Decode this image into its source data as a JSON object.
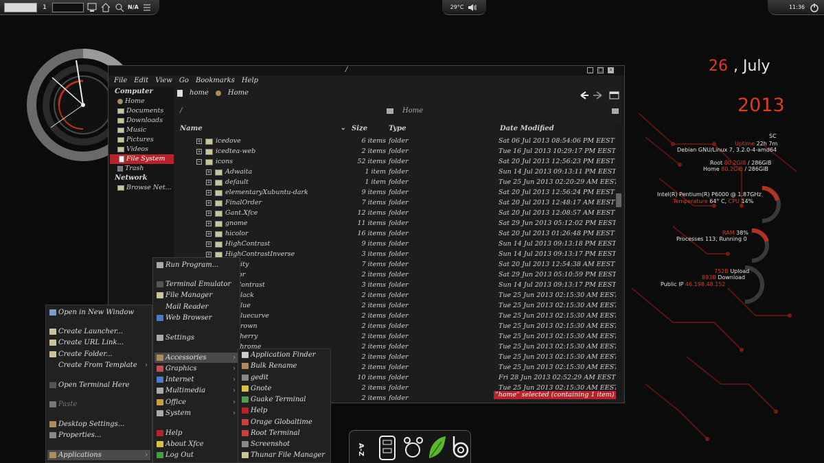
{
  "panel": {
    "workspace_number": "1",
    "network_label": "N/A",
    "temperature": "29°C",
    "clock_time": "11:36"
  },
  "date": {
    "day": "26",
    "month": ", July",
    "year": "2013"
  },
  "conky": {
    "user": "SC",
    "uptime_label": "Uptime",
    "uptime_value": "22h 7m",
    "os": "Debian GNU/Linux 7, 3.2.0-4-amd64",
    "root_label": "Root",
    "root_used": "80.2GiB",
    "root_total": "/ 286GiB",
    "home_label": "Home",
    "home_used": "80.2GiB",
    "home_total": "/ 286GiB",
    "cpu_model": "Intel(R) Pentium(R)  P6000  @ 1.87GHz",
    "temperature_label": "Temperature",
    "temperature_value": "64° C,",
    "cpu_label": "CPU",
    "cpu_value": "14%",
    "ram_label": "RAM",
    "ram_value": "38%",
    "processes": "Processes 113, Running 0",
    "upload_value": "752B",
    "upload_label": "Upload",
    "download_value": "893B",
    "download_label": "Download",
    "public_ip_label": "Public IP",
    "public_ip": "46.198.48.152"
  },
  "file_manager": {
    "title": "/",
    "menu": [
      "File",
      "Edit",
      "View",
      "Go",
      "Bookmarks",
      "Help"
    ],
    "sidebar": {
      "computer_heading": "Computer",
      "computer_items": [
        "Home",
        "Documents",
        "Downloads",
        "Music",
        "Pictures",
        "Videos",
        "File System",
        "Trash"
      ],
      "network_heading": "Network",
      "network_items": [
        "Browse Net..."
      ]
    },
    "path_buttons": [
      "home",
      "Home"
    ],
    "location_left": "/",
    "location_center": "Home",
    "columns": {
      "name": "Name",
      "size": "Size",
      "type": "Type",
      "modified": "Date Modified"
    },
    "rows": [
      {
        "name": "icedove",
        "size": "6 items",
        "type": "folder",
        "date": "Sat 06 Jul 2013 08:54:06 PM EEST",
        "level": 1,
        "exp": "+"
      },
      {
        "name": "icedtea-web",
        "size": "2 items",
        "type": "folder",
        "date": "Tue 16 Jul 2013 10:29:17 PM EEST",
        "level": 1,
        "exp": "+"
      },
      {
        "name": "icons",
        "size": "52 items",
        "type": "folder",
        "date": "Sat 20 Jul 2013 12:56:23 PM EEST",
        "level": 1,
        "exp": "−"
      },
      {
        "name": "Adwaita",
        "size": "1 item",
        "type": "folder",
        "date": "Sun 14 Jul 2013 09:13:11 PM EEST",
        "level": 2,
        "exp": "+"
      },
      {
        "name": "default",
        "size": "1 item",
        "type": "folder",
        "date": "Tue 25 Jun 2013 02:20:29 AM EEST",
        "level": 2,
        "exp": "+"
      },
      {
        "name": "elementaryXubuntu-dark",
        "size": "9 items",
        "type": "folder",
        "date": "Sat 20 Jul 2013 12:56:24 PM EEST",
        "level": 2,
        "exp": "+"
      },
      {
        "name": "FinalOrder",
        "size": "7 items",
        "type": "folder",
        "date": "Sat 20 Jul 2013 12:48:17 AM EEST",
        "level": 2,
        "exp": "+"
      },
      {
        "name": "Gant.Xfce",
        "size": "12 items",
        "type": "folder",
        "date": "Sat 20 Jul 2013 12:08:57 AM EEST",
        "level": 2,
        "exp": "+"
      },
      {
        "name": "gnome",
        "size": "11 items",
        "type": "folder",
        "date": "Sat 29 Jun 2013 05:12:02 PM EEST",
        "level": 2,
        "exp": "+"
      },
      {
        "name": "hicolor",
        "size": "16 items",
        "type": "folder",
        "date": "Sat 20 Jul 2013 01:26:48 PM EEST",
        "level": 2,
        "exp": "+"
      },
      {
        "name": "HighContrast",
        "size": "9 items",
        "type": "folder",
        "date": "Sun 14 Jul 2013 09:13:18 PM EEST",
        "level": 2,
        "exp": "+"
      },
      {
        "name": "HighContrastInverse",
        "size": "3 items",
        "type": "folder",
        "date": "Sun 14 Jul 2013 09:13:17 PM EEST",
        "level": 2,
        "exp": "+"
      },
      {
        "name": "nity",
        "size": "7 items",
        "type": "folder",
        "date": "Sat 20 Jul 2013 12:54:38 AM EEST",
        "level": 2,
        "exp": ""
      },
      {
        "name": "lor",
        "size": "2 items",
        "type": "folder",
        "date": "Sat 29 Jun 2013 05:10:59 PM EEST",
        "level": 2,
        "exp": ""
      },
      {
        "name": "Contrast",
        "size": "3 items",
        "type": "folder",
        "date": "Sun 14 Jul 2013 09:13:17 PM EEST",
        "level": 2,
        "exp": ""
      },
      {
        "name": "black",
        "size": "2 items",
        "type": "folder",
        "date": "Tue 25 Jun 2013 02:15:30 AM EEST",
        "level": 2,
        "exp": ""
      },
      {
        "name": "blue",
        "size": "2 items",
        "type": "folder",
        "date": "Tue 25 Jun 2013 02:15:30 AM EEST",
        "level": 2,
        "exp": ""
      },
      {
        "name": "bluecurve",
        "size": "2 items",
        "type": "folder",
        "date": "Tue 25 Jun 2013 02:15:30 AM EEST",
        "level": 2,
        "exp": ""
      },
      {
        "name": "brown",
        "size": "2 items",
        "type": "folder",
        "date": "Tue 25 Jun 2013 02:15:30 AM EEST",
        "level": 2,
        "exp": ""
      },
      {
        "name": "cherry",
        "size": "2 items",
        "type": "folder",
        "date": "Tue 25 Jun 2013 02:15:30 AM EEST",
        "level": 2,
        "exp": ""
      },
      {
        "name": "chrome",
        "size": "2 items",
        "type": "folder",
        "date": "Tue 25 Jun 2013 02:15:30 AM EEST",
        "level": 2,
        "exp": ""
      },
      {
        "name": "",
        "size": "2 items",
        "type": "folder",
        "date": "Tue 25 Jun 2013 02:15:30 AM EEST",
        "level": 2,
        "exp": ""
      },
      {
        "name": "",
        "size": "2 items",
        "type": "folder",
        "date": "Tue 25 Jun 2013 02:15:30 AM EEST",
        "level": 2,
        "exp": ""
      },
      {
        "name": "",
        "size": "10 items",
        "type": "folder",
        "date": "Fri 28 Jun 2013 02:52:29 AM EEST",
        "level": 2,
        "exp": ""
      },
      {
        "name": "",
        "size": "2 items",
        "type": "folder",
        "date": "Tue 25 Jun 2013 02:15:30 AM EEST",
        "level": 2,
        "exp": ""
      },
      {
        "name": "",
        "size": "2 items",
        "type": "folder",
        "date": "",
        "level": 2,
        "exp": ""
      }
    ],
    "status": "\"home\" selected (containing 1 item)"
  },
  "desktop_menu": {
    "items": [
      {
        "label": "Open in New Window",
        "icon": "#7aa0c8"
      },
      {
        "label": "Create Launcher...",
        "icon": "#c9c49a"
      },
      {
        "label": "Create URL Link...",
        "icon": "#c9c49a"
      },
      {
        "label": "Create Folder...",
        "icon": "#c9c49a"
      },
      {
        "label": "Create From Template",
        "icon": ""
      },
      {
        "label": "Open Terminal Here",
        "icon": "#555"
      },
      {
        "label": "Paste",
        "icon": "#777"
      },
      {
        "label": "Desktop Settings...",
        "icon": "#b08a5a"
      },
      {
        "label": "Properties...",
        "icon": "#888"
      },
      {
        "label": "Applications",
        "icon": "#b08a5a"
      }
    ]
  },
  "apps_menu": {
    "items": [
      {
        "label": "Run Program...",
        "icon": "#aaa"
      },
      {
        "label": "Terminal Emulator",
        "icon": "#555"
      },
      {
        "label": "File Manager",
        "icon": "#c9c49a"
      },
      {
        "label": "Mail Reader",
        "icon": ""
      },
      {
        "label": "Web Browser",
        "icon": "#4a7ac8"
      },
      {
        "label": "Settings",
        "icon": "#aaa"
      },
      {
        "label": "Accessories",
        "icon": "#b08a5a"
      },
      {
        "label": "Graphics",
        "icon": "#c05050"
      },
      {
        "label": "Internet",
        "icon": "#4a7ac8"
      },
      {
        "label": "Multimedia",
        "icon": "#aaa"
      },
      {
        "label": "Office",
        "icon": "#c9a040"
      },
      {
        "label": "System",
        "icon": "#aaa"
      },
      {
        "label": "Help",
        "icon": "#b8222b"
      },
      {
        "label": "About Xfce",
        "icon": "#d8c040"
      },
      {
        "label": "Log Out",
        "icon": "#40a040"
      }
    ]
  },
  "accessories_menu": {
    "items": [
      {
        "label": "Application Finder",
        "icon": "#ccc"
      },
      {
        "label": "Bulk Rename",
        "icon": "#b08a5a"
      },
      {
        "label": "gedit",
        "icon": "#888"
      },
      {
        "label": "Gnote",
        "icon": "#d8c040"
      },
      {
        "label": "Guake Terminal",
        "icon": "#50a050"
      },
      {
        "label": "Help",
        "icon": "#b8222b"
      },
      {
        "label": "Orage Globaltime",
        "icon": "#c84040"
      },
      {
        "label": "Root Terminal",
        "icon": "#c84040"
      },
      {
        "label": "Screenshot",
        "icon": "#888"
      },
      {
        "label": "Thunar File Manager",
        "icon": "#c9c49a"
      }
    ]
  }
}
